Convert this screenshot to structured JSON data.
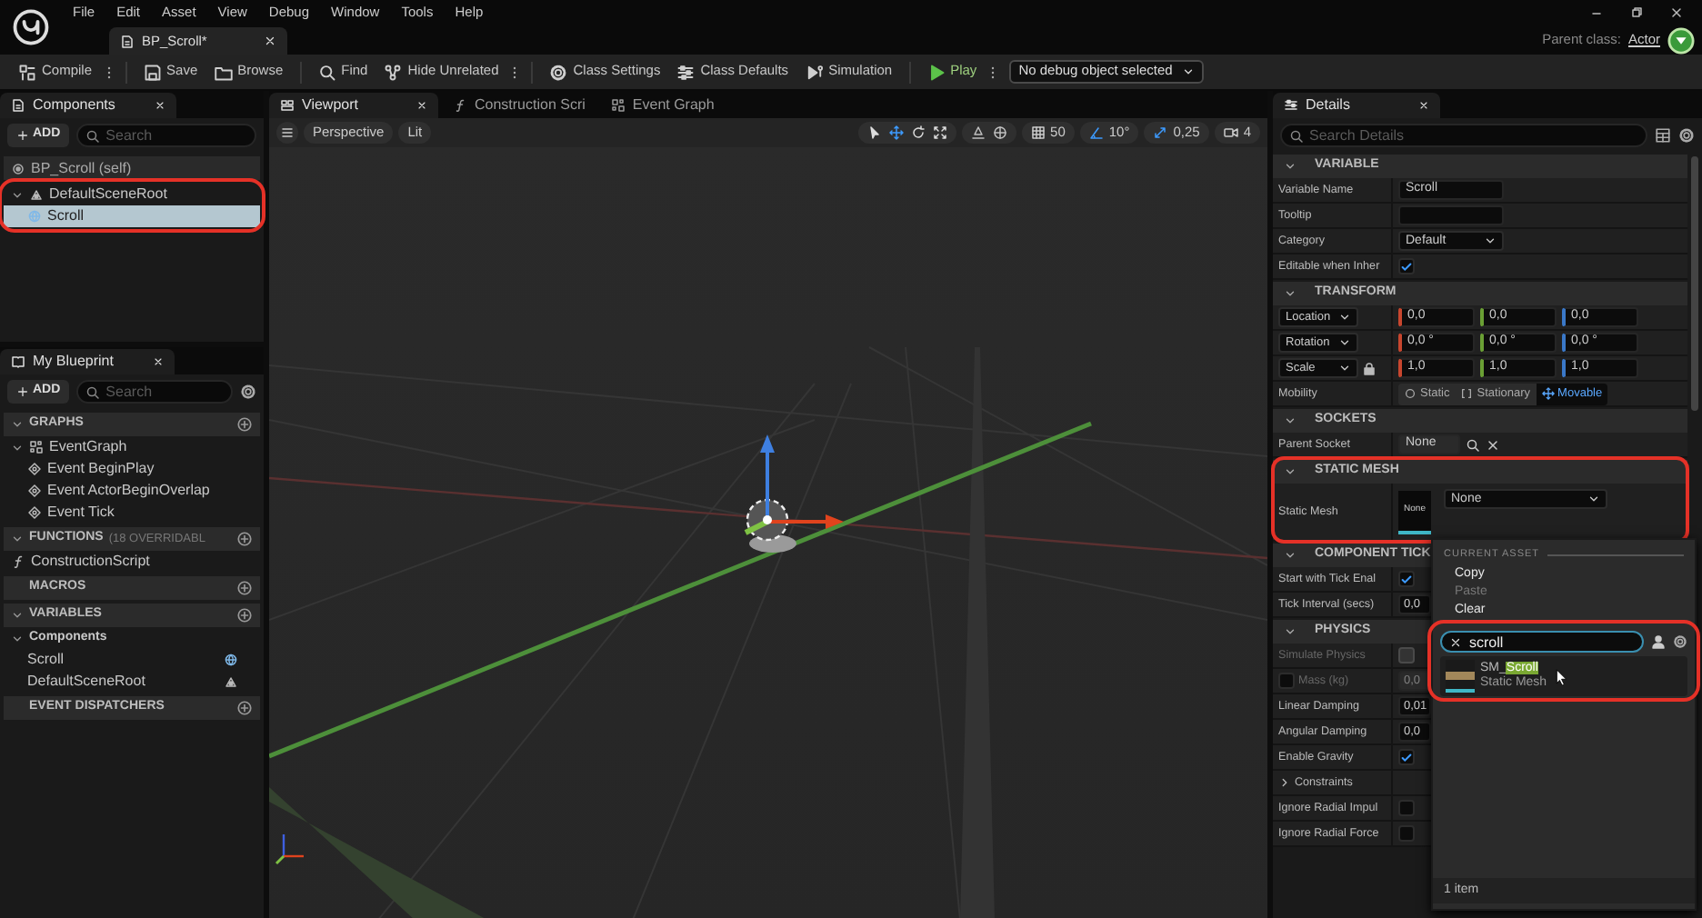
{
  "title_bar": {
    "menu": [
      "File",
      "Edit",
      "Asset",
      "View",
      "Debug",
      "Window",
      "Tools",
      "Help"
    ],
    "document_tab": {
      "label": "BP_Scroll*",
      "selected": true
    },
    "parent_class_label": "Parent class:",
    "parent_class": "Actor"
  },
  "toolbar": {
    "items": [
      {
        "label": "Compile",
        "kind": "compile",
        "has_menu": true,
        "separator_before": false
      },
      {
        "label": "Save",
        "kind": "save",
        "has_menu": false,
        "separator_before": true
      },
      {
        "label": "Browse",
        "kind": "browse",
        "has_menu": false,
        "separator_before": false
      },
      {
        "label": "Find",
        "kind": "find",
        "has_menu": false,
        "separator_before": true
      },
      {
        "label": "Hide Unrelated",
        "kind": "hide",
        "has_menu": true,
        "separator_before": false
      },
      {
        "label": "Class Settings",
        "kind": "settings",
        "has_menu": false,
        "separator_before": true
      },
      {
        "label": "Class Defaults",
        "kind": "defaults",
        "has_menu": false,
        "separator_before": false
      },
      {
        "label": "Simulation",
        "kind": "simulation",
        "has_menu": false,
        "separator_before": false
      },
      {
        "label": "Play",
        "kind": "play",
        "has_menu": true,
        "separator_before": true
      }
    ],
    "debug_filter": "No debug object selected"
  },
  "components": {
    "tab": "Components",
    "add": "ADD",
    "search_placeholder": "Search",
    "self_row": "BP_Scroll (self)",
    "tree": [
      {
        "label": "DefaultSceneRoot",
        "kind": "scene",
        "expanded": true,
        "selected": false,
        "highlighted": true,
        "children": [
          {
            "label": "Scroll",
            "kind": "mesh",
            "selected": true
          }
        ]
      }
    ]
  },
  "my_blueprint": {
    "tab": "My Blueprint",
    "add": "ADD",
    "search_placeholder": "Search",
    "sections": [
      {
        "title": "GRAPHS",
        "expanded": true,
        "items": [
          {
            "label": "EventGraph",
            "kind": "graph",
            "expanded": true,
            "children": [
              {
                "label": "Event BeginPlay",
                "kind": "event"
              },
              {
                "label": "Event ActorBeginOverlap",
                "kind": "event"
              },
              {
                "label": "Event Tick",
                "kind": "event"
              }
            ]
          }
        ]
      },
      {
        "title": "FUNCTIONS",
        "note": "(18 OVERRIDABL",
        "expanded": true,
        "items": [
          {
            "label": "ConstructionScript",
            "kind": "function"
          }
        ]
      },
      {
        "title": "MACROS"
      },
      {
        "title": "VARIABLES",
        "expanded": true,
        "items": [
          {
            "label": "Components",
            "kind": "category",
            "expanded": true,
            "children": [
              {
                "label": "Scroll",
                "kind": "mesh"
              },
              {
                "label": "DefaultSceneRoot",
                "kind": "scene"
              }
            ]
          }
        ]
      },
      {
        "title": "EVENT DISPATCHERS"
      }
    ]
  },
  "editor_tabs": [
    {
      "label": "Viewport",
      "kind": "viewport",
      "selected": true,
      "closable": true
    },
    {
      "label": "Construction Scri",
      "kind": "function",
      "selected": false,
      "closable": false
    },
    {
      "label": "Event Graph",
      "kind": "graph",
      "selected": false,
      "closable": false
    }
  ],
  "viewport": {
    "view_mode": "Perspective",
    "lighting": "Lit",
    "tools": [
      {
        "kind": "select",
        "selected": false
      },
      {
        "kind": "move",
        "selected": true
      },
      {
        "kind": "rotate",
        "selected": false
      },
      {
        "kind": "scale",
        "selected": false
      }
    ],
    "grid_snap": "50",
    "rotation_snap": "10°",
    "scale_snap": "0,25",
    "camera_speed": "4"
  },
  "details": {
    "tab": "Details",
    "search_placeholder": "Search Details",
    "sections": [
      {
        "title": "VARIABLE",
        "expanded": true,
        "highlighted": false,
        "rows": [
          {
            "label": "Variable Name",
            "kind": "text",
            "value": "Scroll"
          },
          {
            "label": "Tooltip",
            "kind": "text"
          },
          {
            "label": "Category",
            "kind": "combo",
            "value": "Default"
          },
          {
            "label": "Editable when Inher",
            "kind": "checkbox",
            "checked": true
          }
        ]
      },
      {
        "title": "TRANSFORM",
        "expanded": true,
        "highlighted": false,
        "rows": [
          {
            "label": "Location",
            "kind": "vector",
            "values": [
              "0,0",
              "0,0",
              "0,0"
            ]
          },
          {
            "label": "Rotation",
            "kind": "vector",
            "values": [
              "0,0 °",
              "0,0 °",
              "0,0 °"
            ]
          },
          {
            "label": "Scale",
            "kind": "vector",
            "values": [
              "1,0",
              "1,0",
              "1,0"
            ],
            "locked": true
          },
          {
            "label": "Mobility",
            "kind": "options",
            "options": [
              {
                "label": "Static",
                "kind": "static",
                "selected": false
              },
              {
                "label": "Stationary",
                "kind": "stationary",
                "selected": false
              },
              {
                "label": "Movable",
                "kind": "movable",
                "selected": true
              }
            ]
          }
        ]
      },
      {
        "title": "SOCKETS",
        "expanded": true,
        "highlighted": false,
        "rows": [
          {
            "label": "Parent Socket",
            "kind": "socket",
            "value": "None"
          }
        ]
      },
      {
        "title": "STATIC MESH",
        "expanded": true,
        "highlighted": true,
        "rows": [
          {
            "label": "Static Mesh",
            "kind": "asset",
            "thumbnail": "None",
            "value": "None"
          }
        ]
      },
      {
        "title": "COMPONENT TICK",
        "expanded": true,
        "highlighted": false,
        "rows": [
          {
            "label": "Start with Tick Enal",
            "kind": "checkbox",
            "checked": true
          },
          {
            "label": "Tick Interval (secs)",
            "kind": "number",
            "value": "0,0"
          }
        ]
      },
      {
        "title": "PHYSICS",
        "expanded": true,
        "highlighted": false,
        "rows": [
          {
            "label": "Simulate Physics",
            "kind": "checkbox",
            "checked": false,
            "disabled": true
          },
          {
            "label": "Mass (kg)",
            "kind": "number",
            "value": "0,0",
            "disabled": true,
            "override": false
          },
          {
            "label": "Linear Damping",
            "kind": "number",
            "value": "0,01",
            "disabled": false
          },
          {
            "label": "Angular Damping",
            "kind": "number",
            "value": "0,0",
            "disabled": false
          },
          {
            "label": "Enable Gravity",
            "kind": "checkbox",
            "checked": true,
            "disabled": false
          },
          {
            "label": "Constraints",
            "kind": "group",
            "expanded": false,
            "disabled": false
          },
          {
            "label": "Ignore Radial Impul",
            "kind": "checkbox",
            "checked": false,
            "disabled": false
          },
          {
            "label": "Ignore Radial Force",
            "kind": "checkbox",
            "checked": false,
            "disabled": false
          }
        ]
      }
    ]
  },
  "asset_picker": {
    "current_header": "CURRENT ASSET",
    "actions": [
      {
        "label": "Copy",
        "disabled": false
      },
      {
        "label": "Paste",
        "disabled": true
      },
      {
        "label": "Clear",
        "disabled": false
      }
    ],
    "search": "scroll",
    "highlighted": true,
    "results": [
      {
        "name_prefix": "SM_",
        "name_match": "Scroll",
        "type": "Static Mesh",
        "selected": true
      }
    ],
    "count": "1 item"
  }
}
